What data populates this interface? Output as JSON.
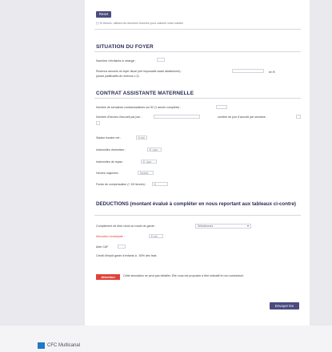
{
  "top": {
    "button": "Reset",
    "note": "(*) Si besoin, utilisez les données fournies pour calculer votre salaire"
  },
  "situation": {
    "title": "SITUATION DU FOYER",
    "children_label": "Nombre d'enfants à charge :",
    "income_label": "Revenus annuels du foyer fiscal (net imposable avant abattement) :",
    "income_label2": "(avant justificatifs de revenus n-2)",
    "income_suffix": "en €"
  },
  "contract": {
    "title": "CONTRAT ASSISTANTE MATERNELLE",
    "weeks_label": "Nombre de semaines contractualisées sur 52 (1 année complète) :",
    "hours_label": "Nombre d'heures d'accueil par jour :",
    "hours_suffix": "nombre de jour d'accueil par semaine :",
    "rows": [
      {
        "label": "Salaire horaire net :",
        "unit": "€ net"
      },
      {
        "label": "Indemnités d'entretien :",
        "unit": "€ / jour"
      },
      {
        "label": "Indemnités de repas :",
        "unit": "€ / jour"
      },
      {
        "label": "Heures majorées :",
        "unit": "heures"
      },
      {
        "label": "Fonds de compensation (+ 45 heures) :",
        "unit": "€"
      }
    ]
  },
  "deductions": {
    "title": "DEDUCTIONS (montant évalué à compléter en nous reportant aux tableaux ci-contre)",
    "caf_label": "Complément de libre choix du mode de garde :",
    "caf_select": "Sélectionnez",
    "partial_label": "Allocation municipale :",
    "partial_value": "€ net",
    "tax_label": "Aide CAF",
    "tax_note": "Crédit d'impôt garde d'enfants à : 50% des frais"
  },
  "attention": {
    "badge": "Attention",
    "text": "Cette simulation ne peut pas détailler. Elle vous est proposée à titre indicatif et non contractuel."
  },
  "submit": "Envoyer les",
  "footer": {
    "logo": "CFC Multicanal"
  }
}
